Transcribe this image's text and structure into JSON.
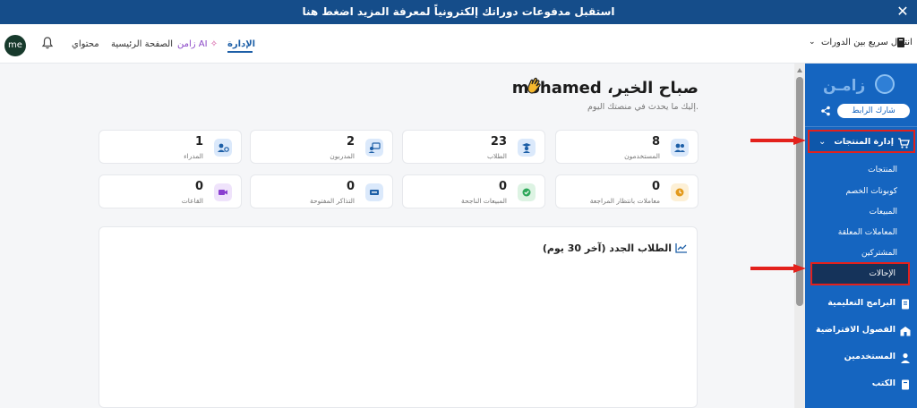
{
  "banner": {
    "text": "استقبل مدفوعات دوراتك إلكترونياً لمعرفة المزيد اضغط هنا",
    "close_glyph": "✕"
  },
  "header": {
    "avatar_initials": "me",
    "nav": {
      "my_content": "محتواي",
      "home": "الصفحة الرئيسية",
      "ai": "زامن AI",
      "admin": "الإدارة"
    },
    "quick_switch": "انتقال سريع بين الدورات",
    "quick_switch_chevron": "⌄"
  },
  "sidebar": {
    "logo_text": "زامـن",
    "share_label": "شارك الرابط",
    "sections": {
      "products": {
        "label": "إدارة المنتجات",
        "chevron": "⌄"
      },
      "programs": {
        "label": "البرامج التعليمية"
      },
      "classrooms": {
        "label": "الفصول الافتراضية",
        "chevron": "›"
      },
      "users": {
        "label": "المستخدمين"
      },
      "books": {
        "label": "الكتب"
      }
    },
    "product_items": [
      "المنتجات",
      "كوبونات الخصم",
      "المبيعات",
      "المعاملات المعلقة",
      "المشتركين",
      "الإحالات"
    ]
  },
  "main": {
    "greeting": "صباح الخير، mohamed",
    "sub_greeting": "إليك ما يحدث في منصتك اليوم.",
    "stats": [
      {
        "value": "8",
        "label": "المستخدمون",
        "icon": "users-icon"
      },
      {
        "value": "23",
        "label": "الطلاب",
        "icon": "student-icon"
      },
      {
        "value": "2",
        "label": "المدربون",
        "icon": "trainer-icon"
      },
      {
        "value": "1",
        "label": "المدراء",
        "icon": "admin-icon"
      },
      {
        "value": "0",
        "label": "معاملات بانتظار المراجعة",
        "icon": "clock-icon"
      },
      {
        "value": "0",
        "label": "المبيعات الناجحة",
        "icon": "check-icon"
      },
      {
        "value": "0",
        "label": "التذاكر المفتوحة",
        "icon": "ticket-icon"
      },
      {
        "value": "0",
        "label": "القاعات",
        "icon": "video-icon"
      }
    ],
    "chart_title": "الطلاب الجدد (آخر 30 يوم)"
  },
  "colors": {
    "banner": "#154d8a",
    "sidebar": "#1565c0",
    "accent": "#1d5fa7",
    "highlight": "#e3211c"
  }
}
